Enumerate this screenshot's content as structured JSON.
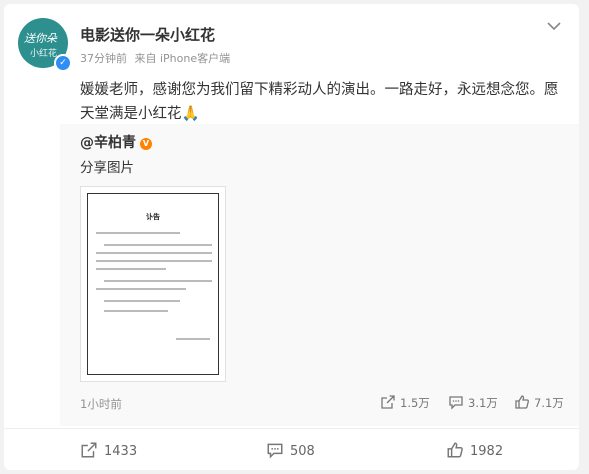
{
  "post": {
    "avatar_text_1": "送你朵",
    "avatar_text_2": "小红花",
    "username": "电影送你一朵小红花",
    "time": "37分钟前",
    "source": "来自 iPhone客户端",
    "content": "媛媛老师，感谢您为我们留下精彩动人的演出。一路走好，永远想念您。愿天堂满是小红花🙏"
  },
  "repost": {
    "username": "@辛柏青",
    "text": "分享图片",
    "image_title": "讣告",
    "time": "1小时前",
    "reposts": "1.5万",
    "comments": "3.1万",
    "likes": "7.1万"
  },
  "footer": {
    "reposts": "1433",
    "comments": "508",
    "likes": "1982"
  },
  "colors": {
    "avatar": "#2e8f8f",
    "verified_blue": "#2f8ef4",
    "verified_orange": "#ff8200"
  }
}
